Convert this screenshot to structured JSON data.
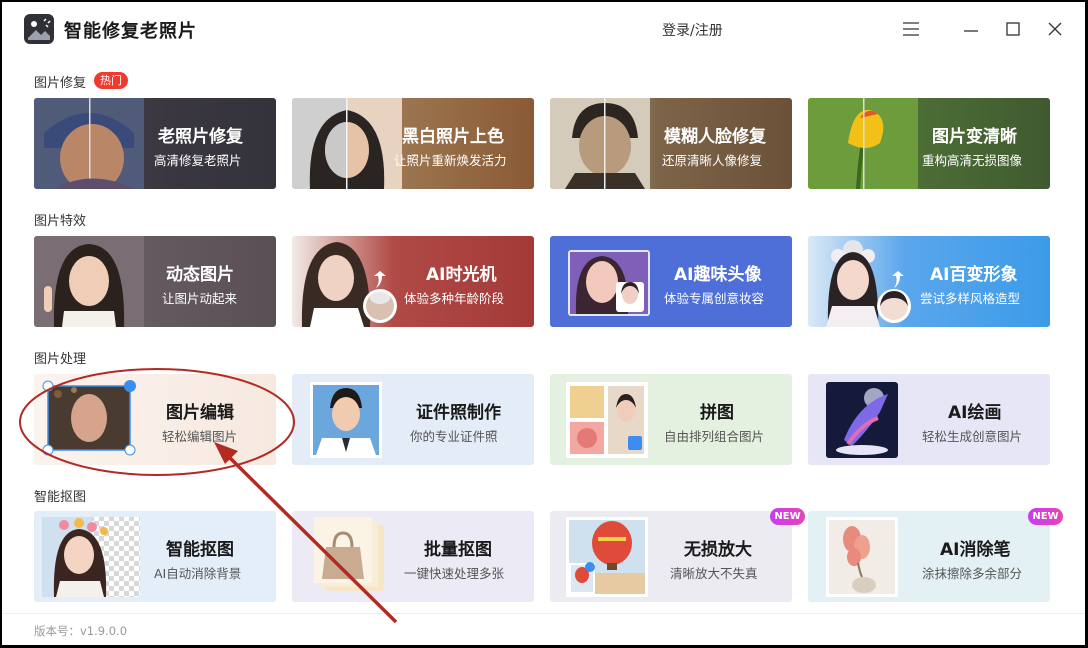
{
  "app": {
    "title": "智能修复老照片",
    "login_label": "登录/注册"
  },
  "sections": [
    {
      "title": "图片修复",
      "badge": "热门"
    },
    {
      "title": "图片特效"
    },
    {
      "title": "图片处理"
    },
    {
      "title": "智能抠图"
    }
  ],
  "cards": {
    "row1": [
      {
        "title": "老照片修复",
        "subtitle": "高清修复老照片"
      },
      {
        "title": "黑白照片上色",
        "subtitle": "让照片重新焕发活力"
      },
      {
        "title": "模糊人脸修复",
        "subtitle": "还原清晰人像修复"
      },
      {
        "title": "图片变清晰",
        "subtitle": "重构高清无损图像"
      }
    ],
    "row2": [
      {
        "title": "动态图片",
        "subtitle": "让图片动起来"
      },
      {
        "title": "AI时光机",
        "subtitle": "体验多种年龄阶段"
      },
      {
        "title": "AI趣味头像",
        "subtitle": "体验专属创意妆容"
      },
      {
        "title": "AI百变形象",
        "subtitle": "尝试多样风格造型"
      }
    ],
    "row3": [
      {
        "title": "图片编辑",
        "subtitle": "轻松编辑图片"
      },
      {
        "title": "证件照制作",
        "subtitle": "你的专业证件照"
      },
      {
        "title": "拼图",
        "subtitle": "自由排列组合图片"
      },
      {
        "title": "AI绘画",
        "subtitle": "轻松生成创意图片"
      }
    ],
    "row4": [
      {
        "title": "智能抠图",
        "subtitle": "AI自动消除背景"
      },
      {
        "title": "批量抠图",
        "subtitle": "一键快速处理多张"
      },
      {
        "title": "无损放大",
        "subtitle": "清晰放大不失真",
        "badge": "NEW"
      },
      {
        "title": "AI消除笔",
        "subtitle": "涂抹擦除多余部分",
        "badge": "NEW"
      }
    ]
  },
  "footer": {
    "version": "版本号：v1.9.0.0"
  },
  "colors": {
    "row1": [
      "#3a3740",
      "#8a5a35",
      "#6b5138",
      "#3f5a30"
    ],
    "row2": [
      "#5a4f55",
      "#a33a38",
      "#4e6fd8",
      "#3b9be8"
    ],
    "row3": [
      "#f6e9e0",
      "#e3ecf7",
      "#e4f1e0",
      "#e7e6f6"
    ],
    "row4": [
      "#e4eef8",
      "#ecebf5",
      "#ecebf2",
      "#e4f1f4"
    ],
    "hot_badge": "#ee3a2f",
    "annotation": "#b32a22"
  }
}
